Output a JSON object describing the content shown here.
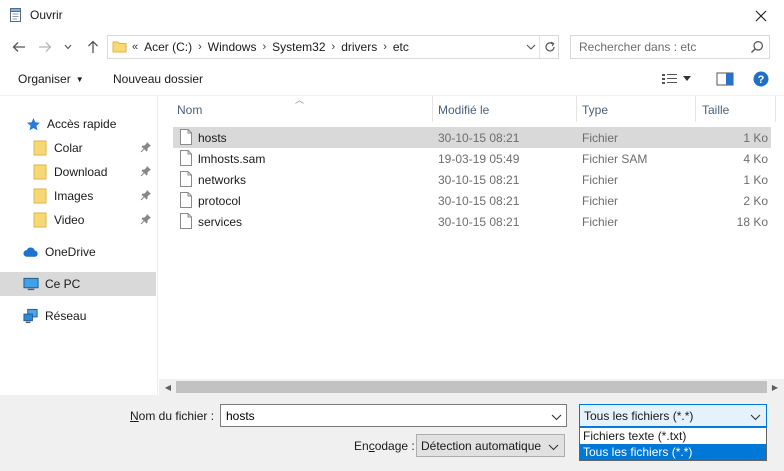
{
  "window": {
    "title": "Ouvrir"
  },
  "address": {
    "overflow": "«",
    "crumbs": [
      "Acer (C:)",
      "Windows",
      "System32",
      "drivers",
      "etc"
    ]
  },
  "search": {
    "placeholder": "Rechercher dans : etc"
  },
  "toolbar": {
    "organize_label": "Organiser",
    "new_folder_label": "Nouveau dossier"
  },
  "sidebar": {
    "items": [
      {
        "label": "Accès rapide",
        "icon": "star-icon"
      },
      {
        "label": "Colar",
        "icon": "folder-icon",
        "pinned": true
      },
      {
        "label": "Download",
        "icon": "folder-icon",
        "pinned": true
      },
      {
        "label": "Images",
        "icon": "folder-icon",
        "pinned": true
      },
      {
        "label": "Video",
        "icon": "folder-icon",
        "pinned": true
      },
      {
        "label": "OneDrive",
        "icon": "cloud-icon"
      },
      {
        "label": "Ce PC",
        "icon": "computer-icon",
        "selected": true
      },
      {
        "label": "Réseau",
        "icon": "network-icon"
      }
    ]
  },
  "columns": {
    "name": "Nom",
    "modified": "Modifié le",
    "type": "Type",
    "size": "Taille"
  },
  "files": [
    {
      "name": "hosts",
      "modified": "30-10-15 08:21",
      "type": "Fichier",
      "size": "1 Ko",
      "selected": true
    },
    {
      "name": "lmhosts.sam",
      "modified": "19-03-19 05:49",
      "type": "Fichier SAM",
      "size": "4 Ko"
    },
    {
      "name": "networks",
      "modified": "30-10-15 08:21",
      "type": "Fichier",
      "size": "1 Ko"
    },
    {
      "name": "protocol",
      "modified": "30-10-15 08:21",
      "type": "Fichier",
      "size": "2 Ko"
    },
    {
      "name": "services",
      "modified": "30-10-15 08:21",
      "type": "Fichier",
      "size": "18 Ko"
    }
  ],
  "bottom": {
    "filename_label_pre": "N",
    "filename_label_rest": "om du fichier :",
    "filename_value": "hosts",
    "filetype_value": "Tous les fichiers  (*.*)",
    "encoding_label_pre": "En",
    "encoding_label_u": "c",
    "encoding_label_rest": "odage :",
    "encoding_value": "Détection automatique",
    "filetype_options": [
      "Fichiers texte (*.txt)",
      "Tous les fichiers  (*.*)"
    ]
  },
  "colors": {
    "accent": "#0078d7",
    "selected_row": "#d9d9d9",
    "header_text": "#4c607a"
  }
}
